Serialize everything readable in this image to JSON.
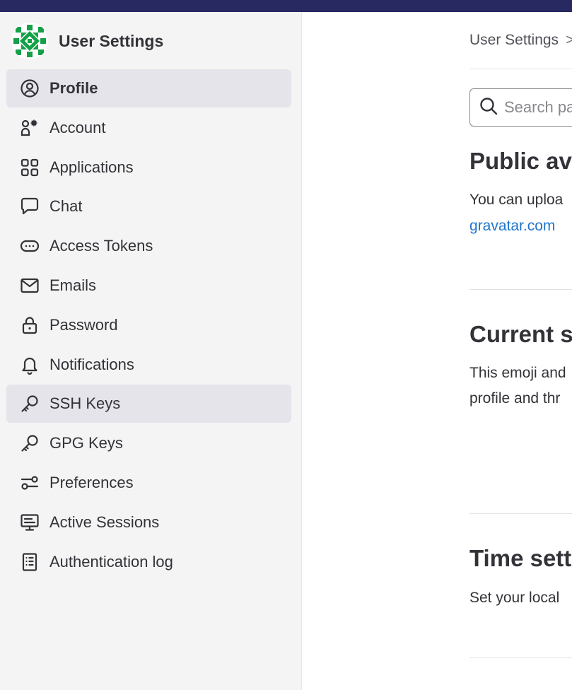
{
  "colors": {
    "topbar": "#292961",
    "sidebar_bg": "#f4f4f4",
    "active_bg": "#e5e4ea",
    "link": "#1f75cb"
  },
  "sidebar": {
    "title": "User Settings",
    "items": [
      {
        "label": "Profile",
        "icon": "profile-icon",
        "state": "active"
      },
      {
        "label": "Account",
        "icon": "account-icon"
      },
      {
        "label": "Applications",
        "icon": "applications-icon"
      },
      {
        "label": "Chat",
        "icon": "chat-icon"
      },
      {
        "label": "Access Tokens",
        "icon": "token-icon"
      },
      {
        "label": "Emails",
        "icon": "email-icon"
      },
      {
        "label": "Password",
        "icon": "lock-icon"
      },
      {
        "label": "Notifications",
        "icon": "bell-icon"
      },
      {
        "label": "SSH Keys",
        "icon": "key-icon",
        "state": "hover"
      },
      {
        "label": "GPG Keys",
        "icon": "key-icon"
      },
      {
        "label": "Preferences",
        "icon": "preferences-icon"
      },
      {
        "label": "Active Sessions",
        "icon": "monitor-icon"
      },
      {
        "label": "Authentication log",
        "icon": "log-icon"
      }
    ]
  },
  "main": {
    "breadcrumb": "User Settings",
    "breadcrumb_separator": ">",
    "search_placeholder": "Search page",
    "sections": [
      {
        "heading": "Public av",
        "text1": "You can uploa",
        "link": "gravatar.com"
      },
      {
        "heading": "Current s",
        "text1": "This emoji and",
        "text2": "profile and thr"
      },
      {
        "heading": "Time sett",
        "text1": "Set your local"
      }
    ]
  }
}
